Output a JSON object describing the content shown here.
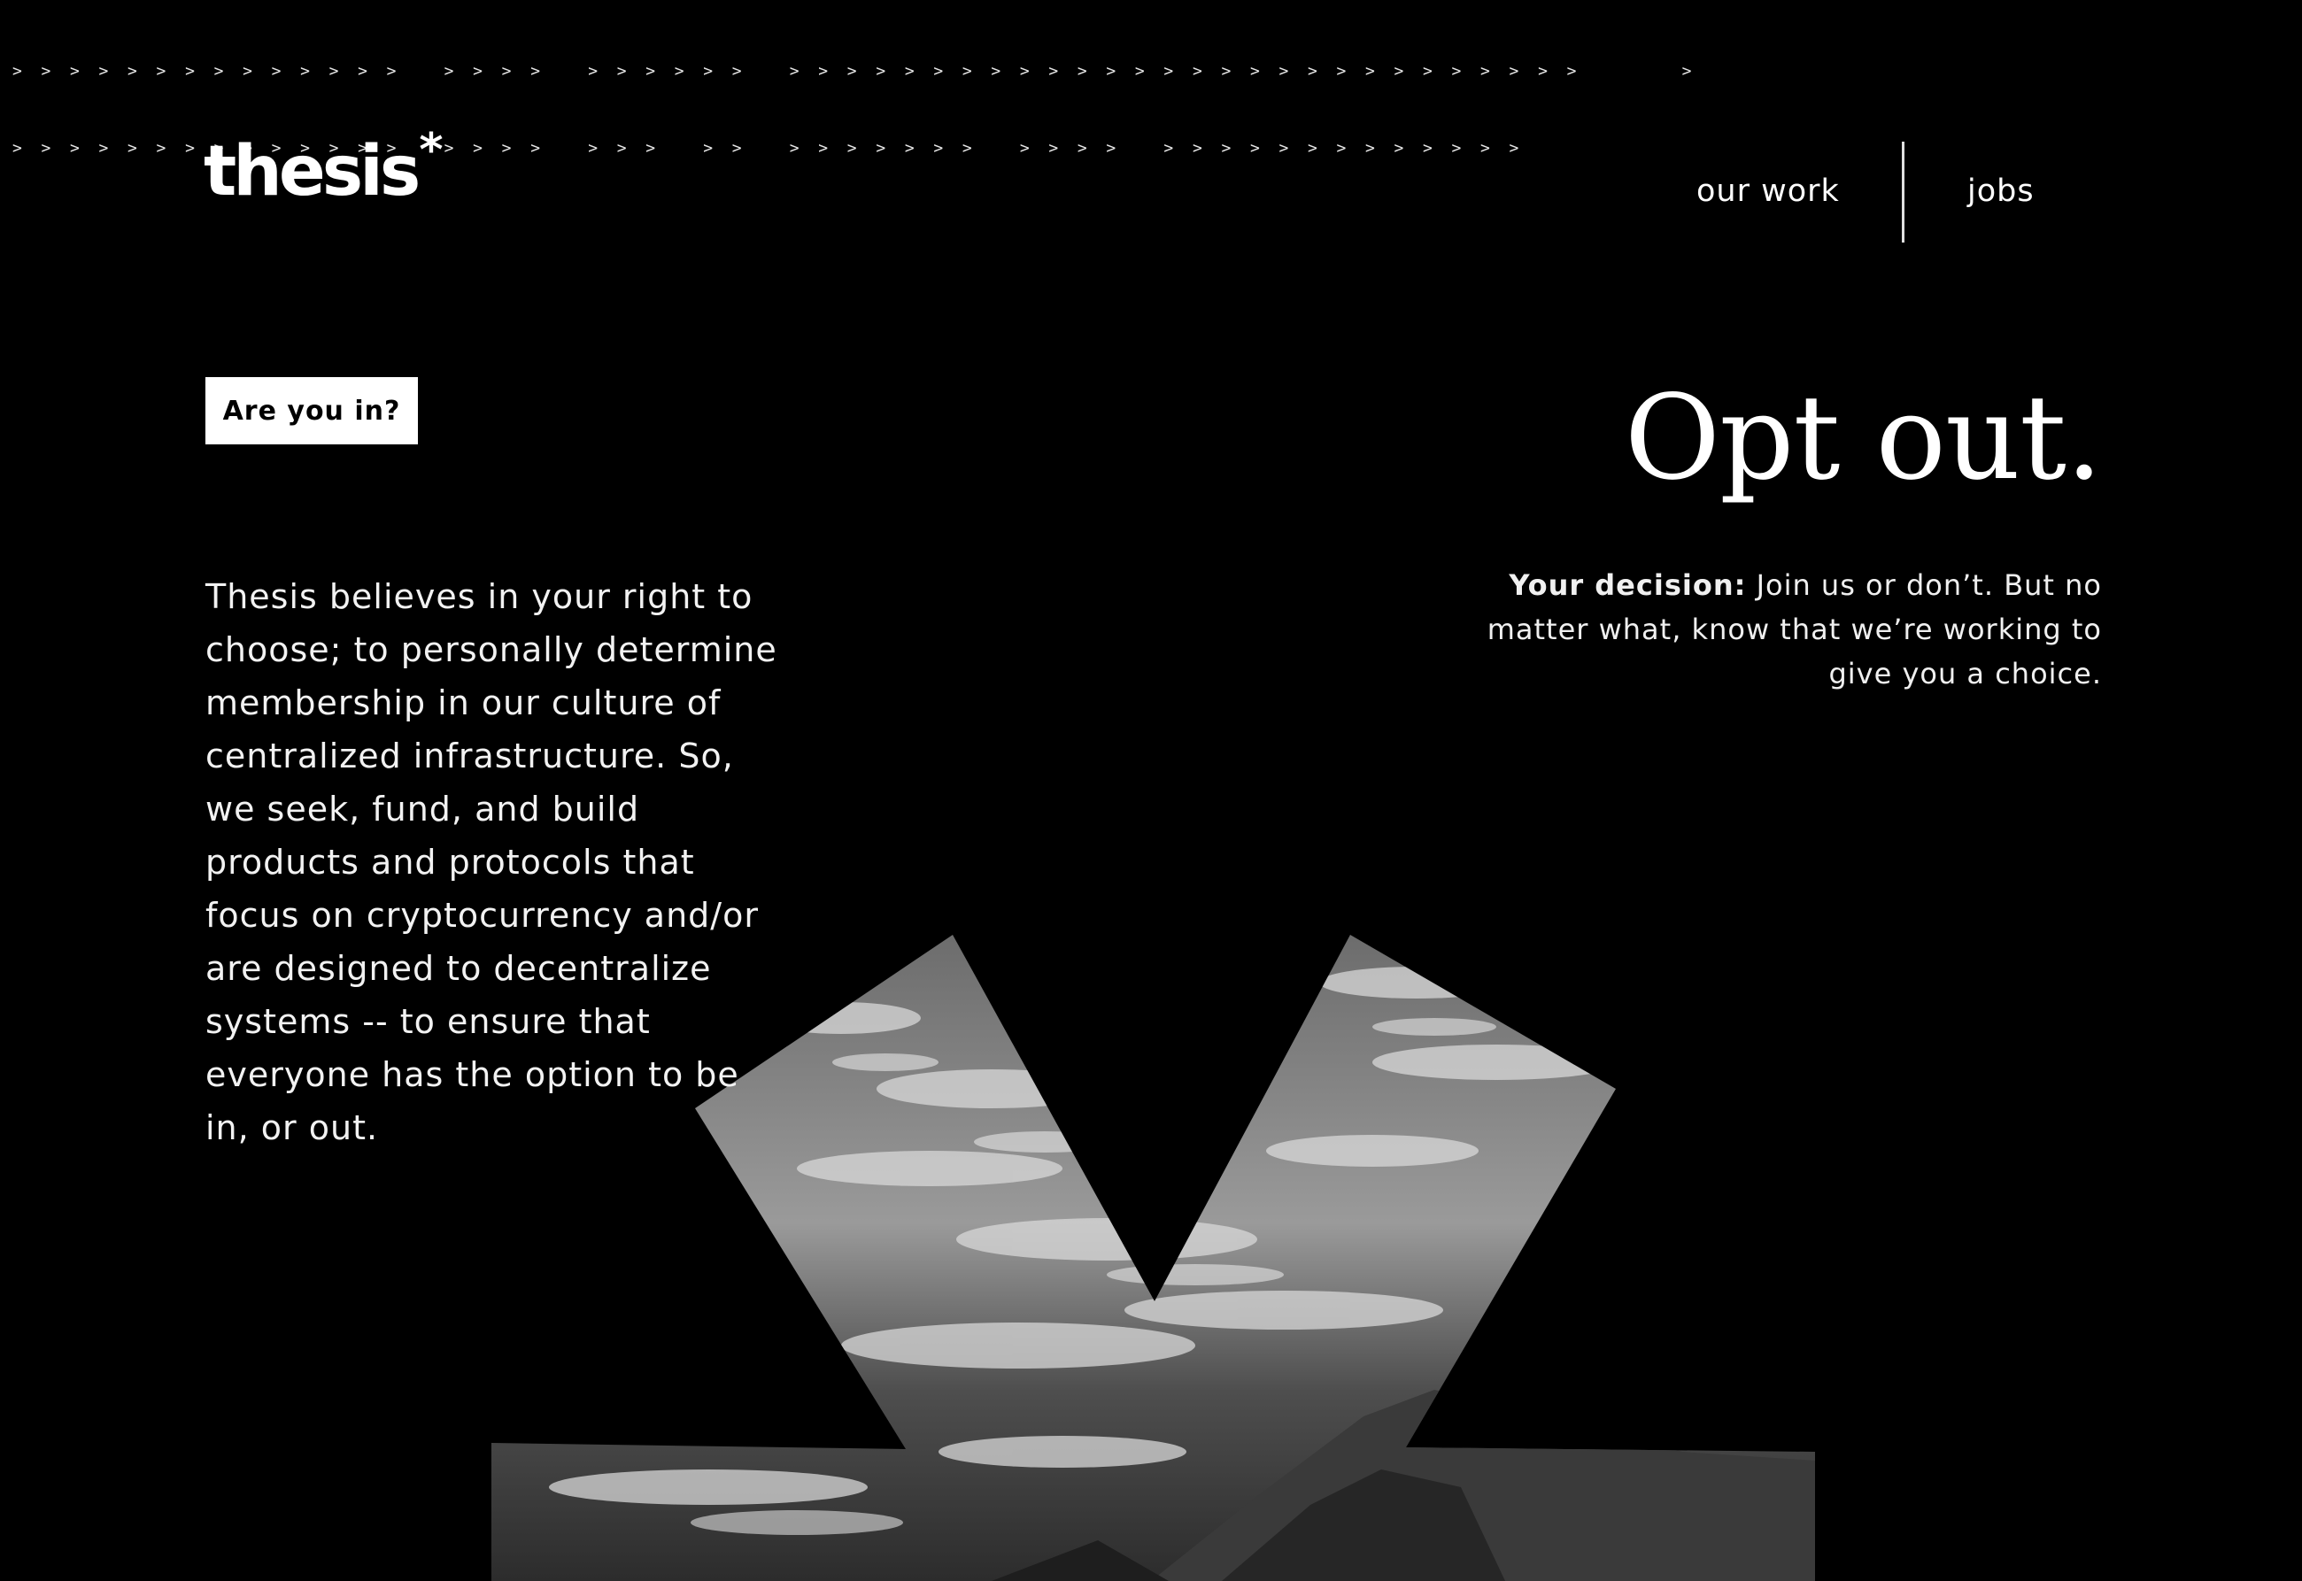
{
  "ticker": {
    "line1": ">  >  >  >  >  >  >  >  >  >  >  >  >  >     >  >  >  >     >  >  >  >  >  >     >  >  >  >  >  >  >  >  >  >  >  >  >  >  >  >  >  >  >  >  >  >  >  >  >  >  >  >           >",
    "line2": ">  >  >  >  >  >  >  >  >  >  >  >  >  >     >  >  >  >     >  >  >     >  >     >  >  >  >  >  >  >     >  >  >  >     >  >  >  >  >  >  >  >  >  >  >  >  >"
  },
  "brand": {
    "name": "thesis",
    "mark": "*"
  },
  "nav": {
    "our_work": "our work",
    "jobs": "jobs"
  },
  "hero": {
    "cta": "Are you in?",
    "body": "Thesis believes in your right to choose; to personally determine membership in our culture of centralized infrastructure. So, we seek, fund, and build products and protocols that focus on cryptocurrency and/or are designed to decentralize systems -- to ensure that everyone has the option to be in, or out.",
    "headline": "Opt out.",
    "decision_label": "Your decision:",
    "decision_text": " Join us or don’t. But no matter what, know that we’re working to give you a choice."
  },
  "colors": {
    "background": "#000000",
    "text": "#ffffff",
    "cta_bg": "#ffffff",
    "cta_text": "#000000"
  },
  "image": {
    "subject": "ocean-waves-and-rocks-photo",
    "mask_shape": "asterisk"
  }
}
